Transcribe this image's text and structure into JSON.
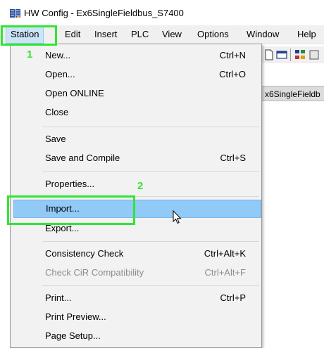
{
  "window": {
    "title": "HW Config - Ex6SingleFieldbus_S7400"
  },
  "menubar": {
    "items": [
      {
        "label": "Station",
        "active": true
      },
      {
        "label": "Edit"
      },
      {
        "label": "Insert"
      },
      {
        "label": "PLC"
      },
      {
        "label": "View"
      },
      {
        "label": "Options"
      },
      {
        "label": "Window"
      },
      {
        "label": "Help"
      }
    ]
  },
  "background": {
    "doc_tab_label": "x6SingleFieldb"
  },
  "dropdown": {
    "items": [
      {
        "label": "New...",
        "shortcut": "Ctrl+N"
      },
      {
        "label": "Open...",
        "shortcut": "Ctrl+O"
      },
      {
        "label": "Open ONLINE",
        "shortcut": ""
      },
      {
        "label": "Close",
        "shortcut": ""
      },
      {
        "label": "Save",
        "shortcut": ""
      },
      {
        "label": "Save and Compile",
        "shortcut": "Ctrl+S"
      },
      {
        "label": "Properties...",
        "shortcut": ""
      },
      {
        "label": "Import...",
        "shortcut": "",
        "hover": true
      },
      {
        "label": "Export...",
        "shortcut": ""
      },
      {
        "label": "Consistency Check",
        "shortcut": "Ctrl+Alt+K"
      },
      {
        "label": "Check CiR Compatibility",
        "shortcut": "Ctrl+Alt+F",
        "disabled": true
      },
      {
        "label": "Print...",
        "shortcut": "Ctrl+P"
      },
      {
        "label": "Print Preview...",
        "shortcut": ""
      },
      {
        "label": "Page Setup...",
        "shortcut": ""
      }
    ]
  },
  "annotations": {
    "step1": "1",
    "step2": "2",
    "highlight_color": "#33e533"
  },
  "colors": {
    "menu_hover": "#91c9f7",
    "menubar_active": "#cce4f7"
  }
}
